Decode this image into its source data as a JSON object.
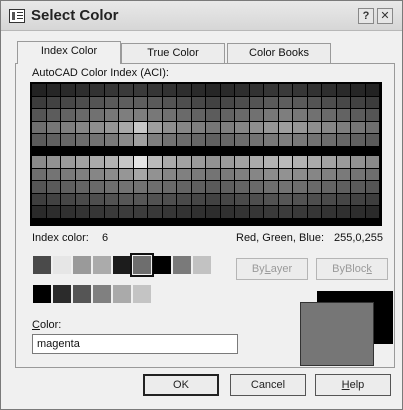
{
  "window": {
    "title": "Select Color",
    "help_glyph": "?",
    "close_glyph": "✕"
  },
  "tabs": [
    {
      "label": "Index Color",
      "active": true
    },
    {
      "label": "True Color",
      "active": false
    },
    {
      "label": "Color Books",
      "active": false
    }
  ],
  "aci_label": "AutoCAD Color Index (ACI):",
  "palette": {
    "upper_rows": [
      [
        "#222",
        "#262626",
        "#2a2a2a",
        "#2e2e2e",
        "#323232",
        "#363636",
        "#3a3a3a",
        "#3a3a3a",
        "#363636",
        "#323232",
        "#2e2e2e",
        "#2a2a2a",
        "#262626",
        "#2a2a2a",
        "#2e2e2e",
        "#323232",
        "#363636",
        "#3a3a3a",
        "#363636",
        "#323232",
        "#2e2e2e",
        "#2a2a2a",
        "#262626",
        "#222"
      ],
      [
        "#3c3c3c",
        "#424242",
        "#484848",
        "#4e4e4e",
        "#545454",
        "#5a5a5a",
        "#5e5e5e",
        "#5e5e5e",
        "#5a5a5a",
        "#545454",
        "#4e4e4e",
        "#484848",
        "#424242",
        "#484848",
        "#4e4e4e",
        "#545454",
        "#5a5a5a",
        "#5e5e5e",
        "#5a5a5a",
        "#545454",
        "#4e4e4e",
        "#484848",
        "#424242",
        "#3c3c3c"
      ],
      [
        "#555",
        "#5c5c5c",
        "#636363",
        "#6a6a6a",
        "#717171",
        "#787878",
        "#7e7e7e",
        "#7e7e7e",
        "#787878",
        "#717171",
        "#6a6a6a",
        "#636363",
        "#5c5c5c",
        "#636363",
        "#6a6a6a",
        "#717171",
        "#787878",
        "#7e7e7e",
        "#787878",
        "#717171",
        "#6a6a6a",
        "#636363",
        "#5c5c5c",
        "#555"
      ],
      [
        "#6e6e6e",
        "#767676",
        "#7e7e7e",
        "#868686",
        "#8e8e8e",
        "#969696",
        "#a8a8a8",
        "#c8c8c8",
        "#9e9e9e",
        "#8e8e8e",
        "#868686",
        "#7e7e7e",
        "#767676",
        "#7e7e7e",
        "#868686",
        "#8e8e8e",
        "#969696",
        "#9e9e9e",
        "#969696",
        "#8e8e8e",
        "#868686",
        "#7e7e7e",
        "#767676",
        "#6e6e6e"
      ],
      [
        "#5a5a5a",
        "#606060",
        "#666666",
        "#6c6c6c",
        "#727272",
        "#787878",
        "#8a8a8a",
        "#a0a0a0",
        "#7e7e7e",
        "#727272",
        "#6c6c6c",
        "#666666",
        "#606060",
        "#666666",
        "#6c6c6c",
        "#727272",
        "#787878",
        "#7e7e7e",
        "#787878",
        "#727272",
        "#6c6c6c",
        "#666666",
        "#606060",
        "#5a5a5a"
      ]
    ],
    "lower_rows": [
      [
        "#8a8a8a",
        "#929292",
        "#9a9a9a",
        "#a2a2a2",
        "#aaaaaa",
        "#b2b2b2",
        "#c6c6c6",
        "#e4e4e4",
        "#bababa",
        "#aaaaaa",
        "#a2a2a2",
        "#9a9a9a",
        "#929292",
        "#9a9a9a",
        "#a2a2a2",
        "#aaaaaa",
        "#b2b2b2",
        "#bababa",
        "#b2b2b2",
        "#aaaaaa",
        "#a2a2a2",
        "#9a9a9a",
        "#929292",
        "#8a8a8a"
      ],
      [
        "#6e6e6e",
        "#747474",
        "#7a7a7a",
        "#808080",
        "#868686",
        "#8c8c8c",
        "#969696",
        "#a6a6a6",
        "#929292",
        "#868686",
        "#808080",
        "#7a7a7a",
        "#747474",
        "#7a7a7a",
        "#808080",
        "#868686",
        "#8c8c8c",
        "#929292",
        "#8c8c8c",
        "#868686",
        "#808080",
        "#7a7a7a",
        "#747474",
        "#6e6e6e"
      ],
      [
        "#555",
        "#5a5a5a",
        "#5f5f5f",
        "#646464",
        "#696969",
        "#6e6e6e",
        "#727272",
        "#727272",
        "#6e6e6e",
        "#696969",
        "#646464",
        "#5f5f5f",
        "#5a5a5a",
        "#5f5f5f",
        "#646464",
        "#696969",
        "#6e6e6e",
        "#727272",
        "#6e6e6e",
        "#696969",
        "#646464",
        "#5f5f5f",
        "#5a5a5a",
        "#555"
      ],
      [
        "#3e3e3e",
        "#424242",
        "#464646",
        "#4a4a4a",
        "#4e4e4e",
        "#525252",
        "#565656",
        "#565656",
        "#525252",
        "#4e4e4e",
        "#4a4a4a",
        "#464646",
        "#424242",
        "#464646",
        "#4a4a4a",
        "#4e4e4e",
        "#525252",
        "#565656",
        "#525252",
        "#4e4e4e",
        "#4a4a4a",
        "#464646",
        "#424242",
        "#3e3e3e"
      ],
      [
        "#2a2a2a",
        "#2d2d2d",
        "#303030",
        "#333333",
        "#363636",
        "#393939",
        "#3c3c3c",
        "#3c3c3c",
        "#393939",
        "#363636",
        "#333333",
        "#303030",
        "#2d2d2d",
        "#303030",
        "#333333",
        "#363636",
        "#393939",
        "#3c3c3c",
        "#393939",
        "#363636",
        "#333333",
        "#303030",
        "#2d2d2d",
        "#2a2a2a"
      ]
    ]
  },
  "index_color_label": "Index color:",
  "index_color_value": "6",
  "rgb_label": "Red, Green, Blue:",
  "rgb_value": "255,0,255",
  "standard_colors": [
    "#4a4a4a",
    "#e6e6e6",
    "#9a9a9a",
    "#ababab",
    "#1c1c1c",
    "#6e6e6e",
    "#000000",
    "#7a7a7a",
    "#c2c2c2"
  ],
  "gray_colors": [
    "#000000",
    "#2b2b2b",
    "#555555",
    "#808080",
    "#aaaaaa",
    "#c4c4c4"
  ],
  "selected_swatch_index": 5,
  "bylayer_pre": "By",
  "bylayer_u": "L",
  "bylayer_post": "ayer",
  "byblock_pre": "ByBloc",
  "byblock_u": "k",
  "byblock_post": "",
  "color_label_u": "C",
  "color_label_rest": "olor:",
  "color_value": "magenta",
  "preview": {
    "new_color": "#767676",
    "old_color": "#000000"
  },
  "footer": {
    "ok": "OK",
    "cancel": "Cancel",
    "help_u": "H",
    "help_rest": "elp"
  }
}
